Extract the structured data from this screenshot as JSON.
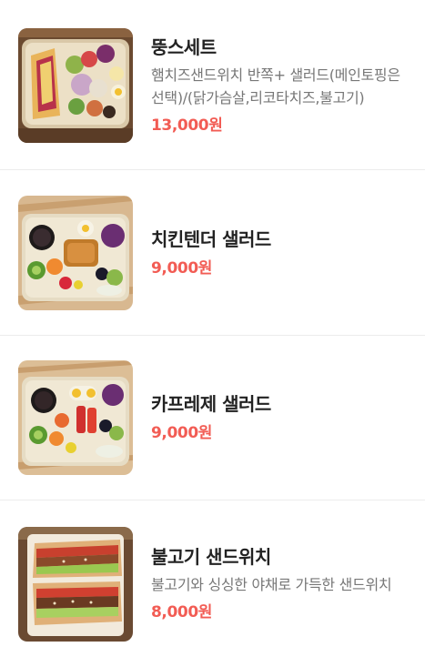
{
  "menu": [
    {
      "name": "뚱스세트",
      "description": "햄치즈샌드위치 반쪽+ 샐러드(메인토핑은 선택)/(닭가슴살,리코타치즈,불고기)",
      "price": "13,000원",
      "image": "sandwich-salad-set-photo"
    },
    {
      "name": "치킨텐더 샐러드",
      "description": "",
      "price": "9,000원",
      "image": "chicken-tender-salad-photo"
    },
    {
      "name": "카프레제 샐러드",
      "description": "",
      "price": "9,000원",
      "image": "caprese-salad-photo"
    },
    {
      "name": "불고기 샌드위치",
      "description": "불고기와 싱싱한 야채로 가득한 샌드위치",
      "price": "8,000원",
      "image": "bulgogi-sandwich-photo"
    }
  ],
  "colors": {
    "price": "#f25c54",
    "name": "#222222",
    "description": "#777777",
    "divider": "#ececec"
  }
}
